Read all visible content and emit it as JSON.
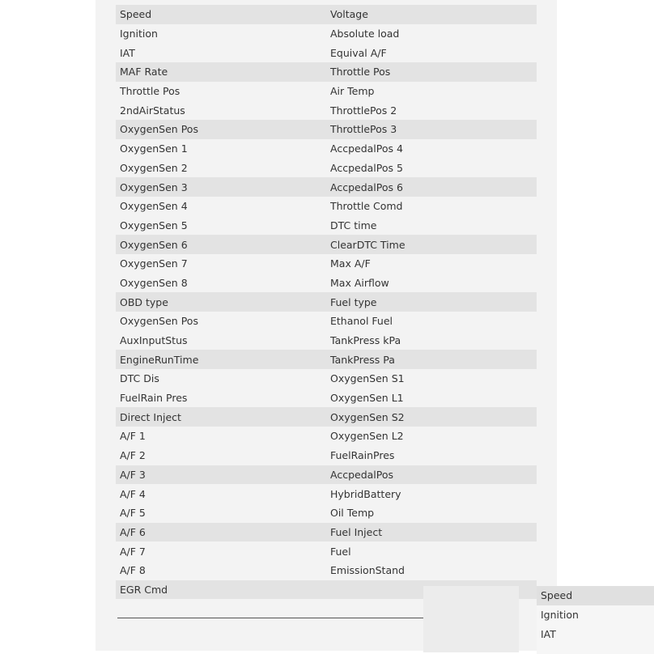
{
  "rows": [
    [
      "Speed",
      "Voltage"
    ],
    [
      "Ignition",
      "Absolute load"
    ],
    [
      "IAT",
      "Equival A/F"
    ],
    [
      "MAF Rate",
      "Throttle Pos"
    ],
    [
      "Throttle Pos",
      "Air Temp"
    ],
    [
      "2ndAirStatus",
      "ThrottlePos 2"
    ],
    [
      "OxygenSen Pos",
      "ThrottlePos 3"
    ],
    [
      "OxygenSen 1",
      "AccpedalPos 4"
    ],
    [
      "OxygenSen 2",
      "AccpedalPos 5"
    ],
    [
      "OxygenSen 3",
      "AccpedalPos 6"
    ],
    [
      "OxygenSen 4",
      "Throttle Comd"
    ],
    [
      "OxygenSen 5",
      "DTC time"
    ],
    [
      "OxygenSen 6",
      "ClearDTC Time"
    ],
    [
      "OxygenSen 7",
      "Max A/F"
    ],
    [
      "OxygenSen 8",
      "Max Airflow"
    ],
    [
      "OBD type",
      "Fuel type"
    ],
    [
      "OxygenSen Pos",
      "Ethanol Fuel"
    ],
    [
      "AuxInputStus",
      "TankPress kPa"
    ],
    [
      "EngineRunTime",
      "TankPress Pa"
    ],
    [
      "DTC Dis",
      "OxygenSen S1"
    ],
    [
      "FuelRain Pres",
      "OxygenSen L1"
    ],
    [
      "Direct Inject",
      "OxygenSen S2"
    ],
    [
      "A/F 1",
      "OxygenSen L2"
    ],
    [
      "A/F 2",
      "FuelRainPres"
    ],
    [
      "A/F 3",
      "AccpedalPos"
    ],
    [
      "A/F 4",
      "HybridBattery"
    ],
    [
      "A/F 5",
      "Oil Temp"
    ],
    [
      "A/F 6",
      "Fuel Inject"
    ],
    [
      "A/F 7",
      "Fuel"
    ],
    [
      "A/F 8",
      "EmissionStand"
    ],
    [
      "EGR Cmd",
      ""
    ]
  ],
  "dropdown": {
    "items": [
      "Speed",
      "Ignition",
      "IAT"
    ],
    "selected": 0
  }
}
